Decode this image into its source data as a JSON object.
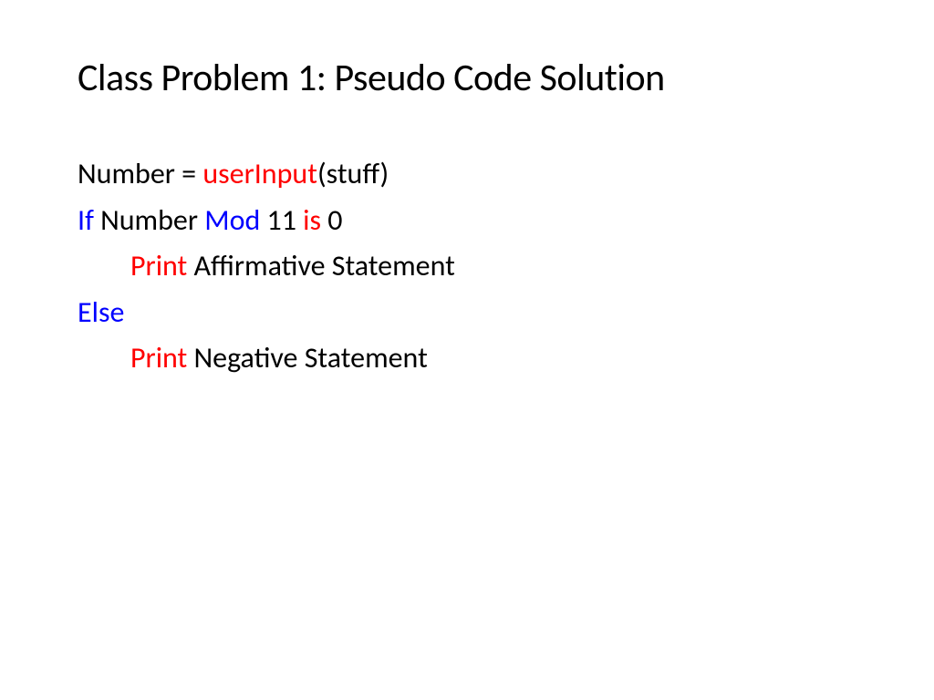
{
  "title": "Class Problem 1: Pseudo Code Solution",
  "code": {
    "line1": {
      "part1": "Number = ",
      "part2": "userInput",
      "part3": "(stuff)"
    },
    "line2": {
      "part1": "If",
      "part2": " Number ",
      "part3": "Mod",
      "part4": " 11 ",
      "part5": "is",
      "part6": " 0"
    },
    "line3": {
      "part1": "Print",
      "part2": "  Affirmative Statement"
    },
    "line4": {
      "part1": "Else"
    },
    "line5": {
      "part1": "Print",
      "part2": " Negative Statement"
    }
  }
}
